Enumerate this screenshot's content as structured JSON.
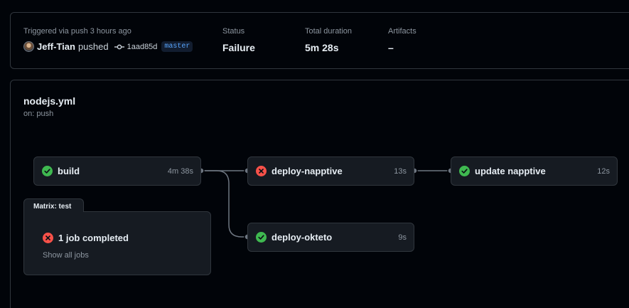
{
  "summary": {
    "trigger_label": "Triggered via push 3 hours ago",
    "user": "Jeff-Tian",
    "action": "pushed",
    "commit_sha": "1aad85d",
    "branch": "master",
    "status_label": "Status",
    "status_value": "Failure",
    "duration_label": "Total duration",
    "duration_value": "5m 28s",
    "artifacts_label": "Artifacts",
    "artifacts_value": "–"
  },
  "workflow": {
    "file": "nodejs.yml",
    "trigger": "on: push"
  },
  "jobs": {
    "build": {
      "name": "build",
      "duration": "4m 38s",
      "status": "success"
    },
    "deploy_napptive": {
      "name": "deploy-napptive",
      "duration": "13s",
      "status": "failure"
    },
    "update_napptive": {
      "name": "update napptive",
      "duration": "12s",
      "status": "success"
    },
    "deploy_okteto": {
      "name": "deploy-okteto",
      "duration": "9s",
      "status": "success"
    }
  },
  "matrix": {
    "label": "Matrix: test",
    "status_text": "1 job completed",
    "show_all": "Show all jobs",
    "status": "failure"
  },
  "colors": {
    "success": "#3fb950",
    "failure": "#f85149",
    "link": "#58a6ff",
    "muted": "#8d96a0"
  }
}
